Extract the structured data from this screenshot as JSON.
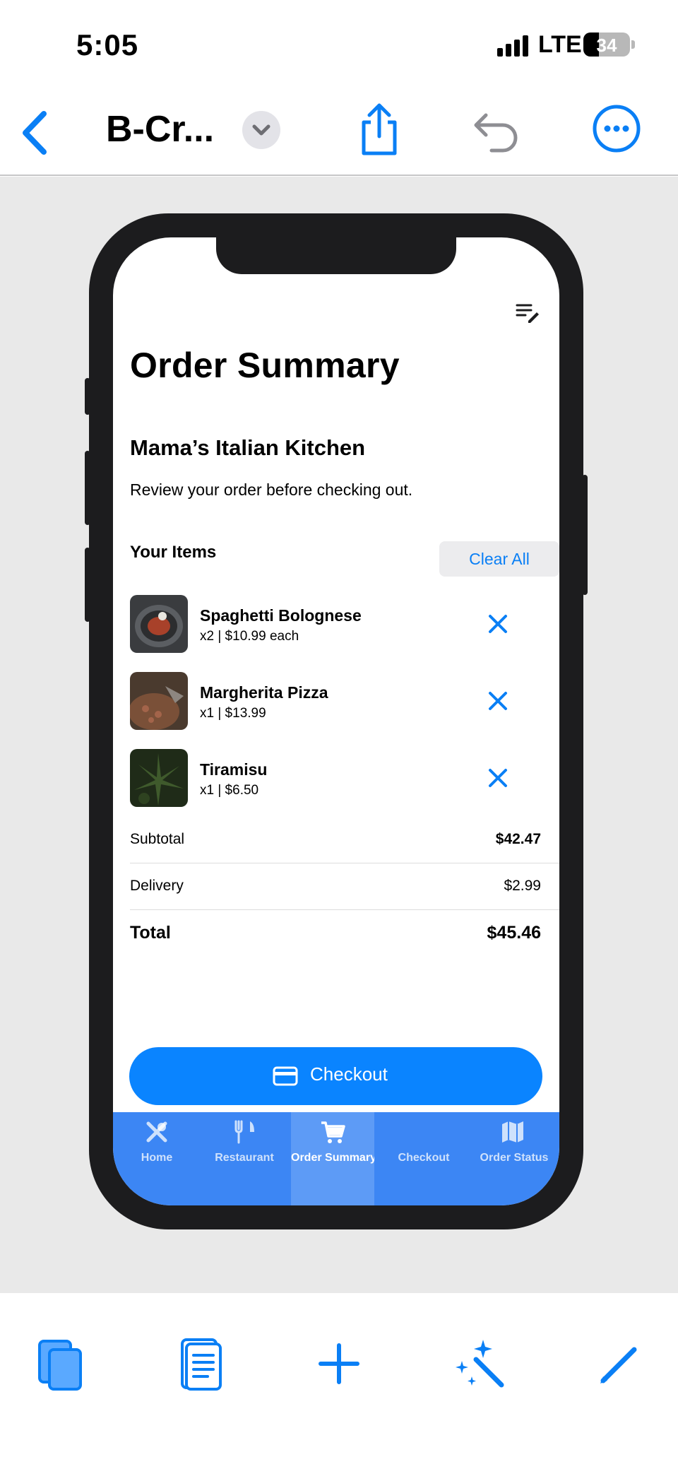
{
  "status_bar": {
    "time": "5:05",
    "network": "LTE",
    "battery_percent": "34",
    "battery_level": 0.34,
    "signal_bars": 4
  },
  "app_toolbar": {
    "document_title": "B-Cr...",
    "icons": [
      "chevron-left-icon",
      "chevron-down-icon",
      "share-icon",
      "undo-icon",
      "more-icon"
    ]
  },
  "colors": {
    "accent": "#0a84ff",
    "tab_bar": "#3c86f4",
    "phone_frame": "#1c1c1e",
    "canvas": "#e9e9e9"
  },
  "app": {
    "title": "Order Summary",
    "restaurant": "Mama’s Italian Kitchen",
    "subtitle": "Review your order before checking out.",
    "items_heading": "Your Items",
    "clear_all_label": "Clear All",
    "items": [
      {
        "name": "Spaghetti Bolognese",
        "meta": "x2  |  $10.99 each"
      },
      {
        "name": "Margherita Pizza",
        "meta": "x1  |  $13.99"
      },
      {
        "name": "Tiramisu",
        "meta": "x1  |  $6.50"
      }
    ],
    "totals": {
      "subtotal_label": "Subtotal",
      "subtotal_value": "$42.47",
      "delivery_label": "Delivery",
      "delivery_value": "$2.99",
      "total_label": "Total",
      "total_value": "$45.46"
    },
    "checkout_label": "Checkout",
    "tabs": [
      {
        "label": "Home",
        "icon": "utensils-cross-icon"
      },
      {
        "label": "Restaurant",
        "icon": "fork-knife-icon"
      },
      {
        "label": "Order Summary",
        "icon": "cart-icon"
      },
      {
        "label": "Checkout",
        "icon": "credit-card-icon"
      },
      {
        "label": "Order Status",
        "icon": "map-icon"
      }
    ],
    "active_tab": "Order Summary"
  },
  "bottom_toolbar": {
    "icons": [
      "pages-icon",
      "document-icon",
      "plus-icon",
      "magic-wand-icon",
      "pencil-icon"
    ]
  }
}
